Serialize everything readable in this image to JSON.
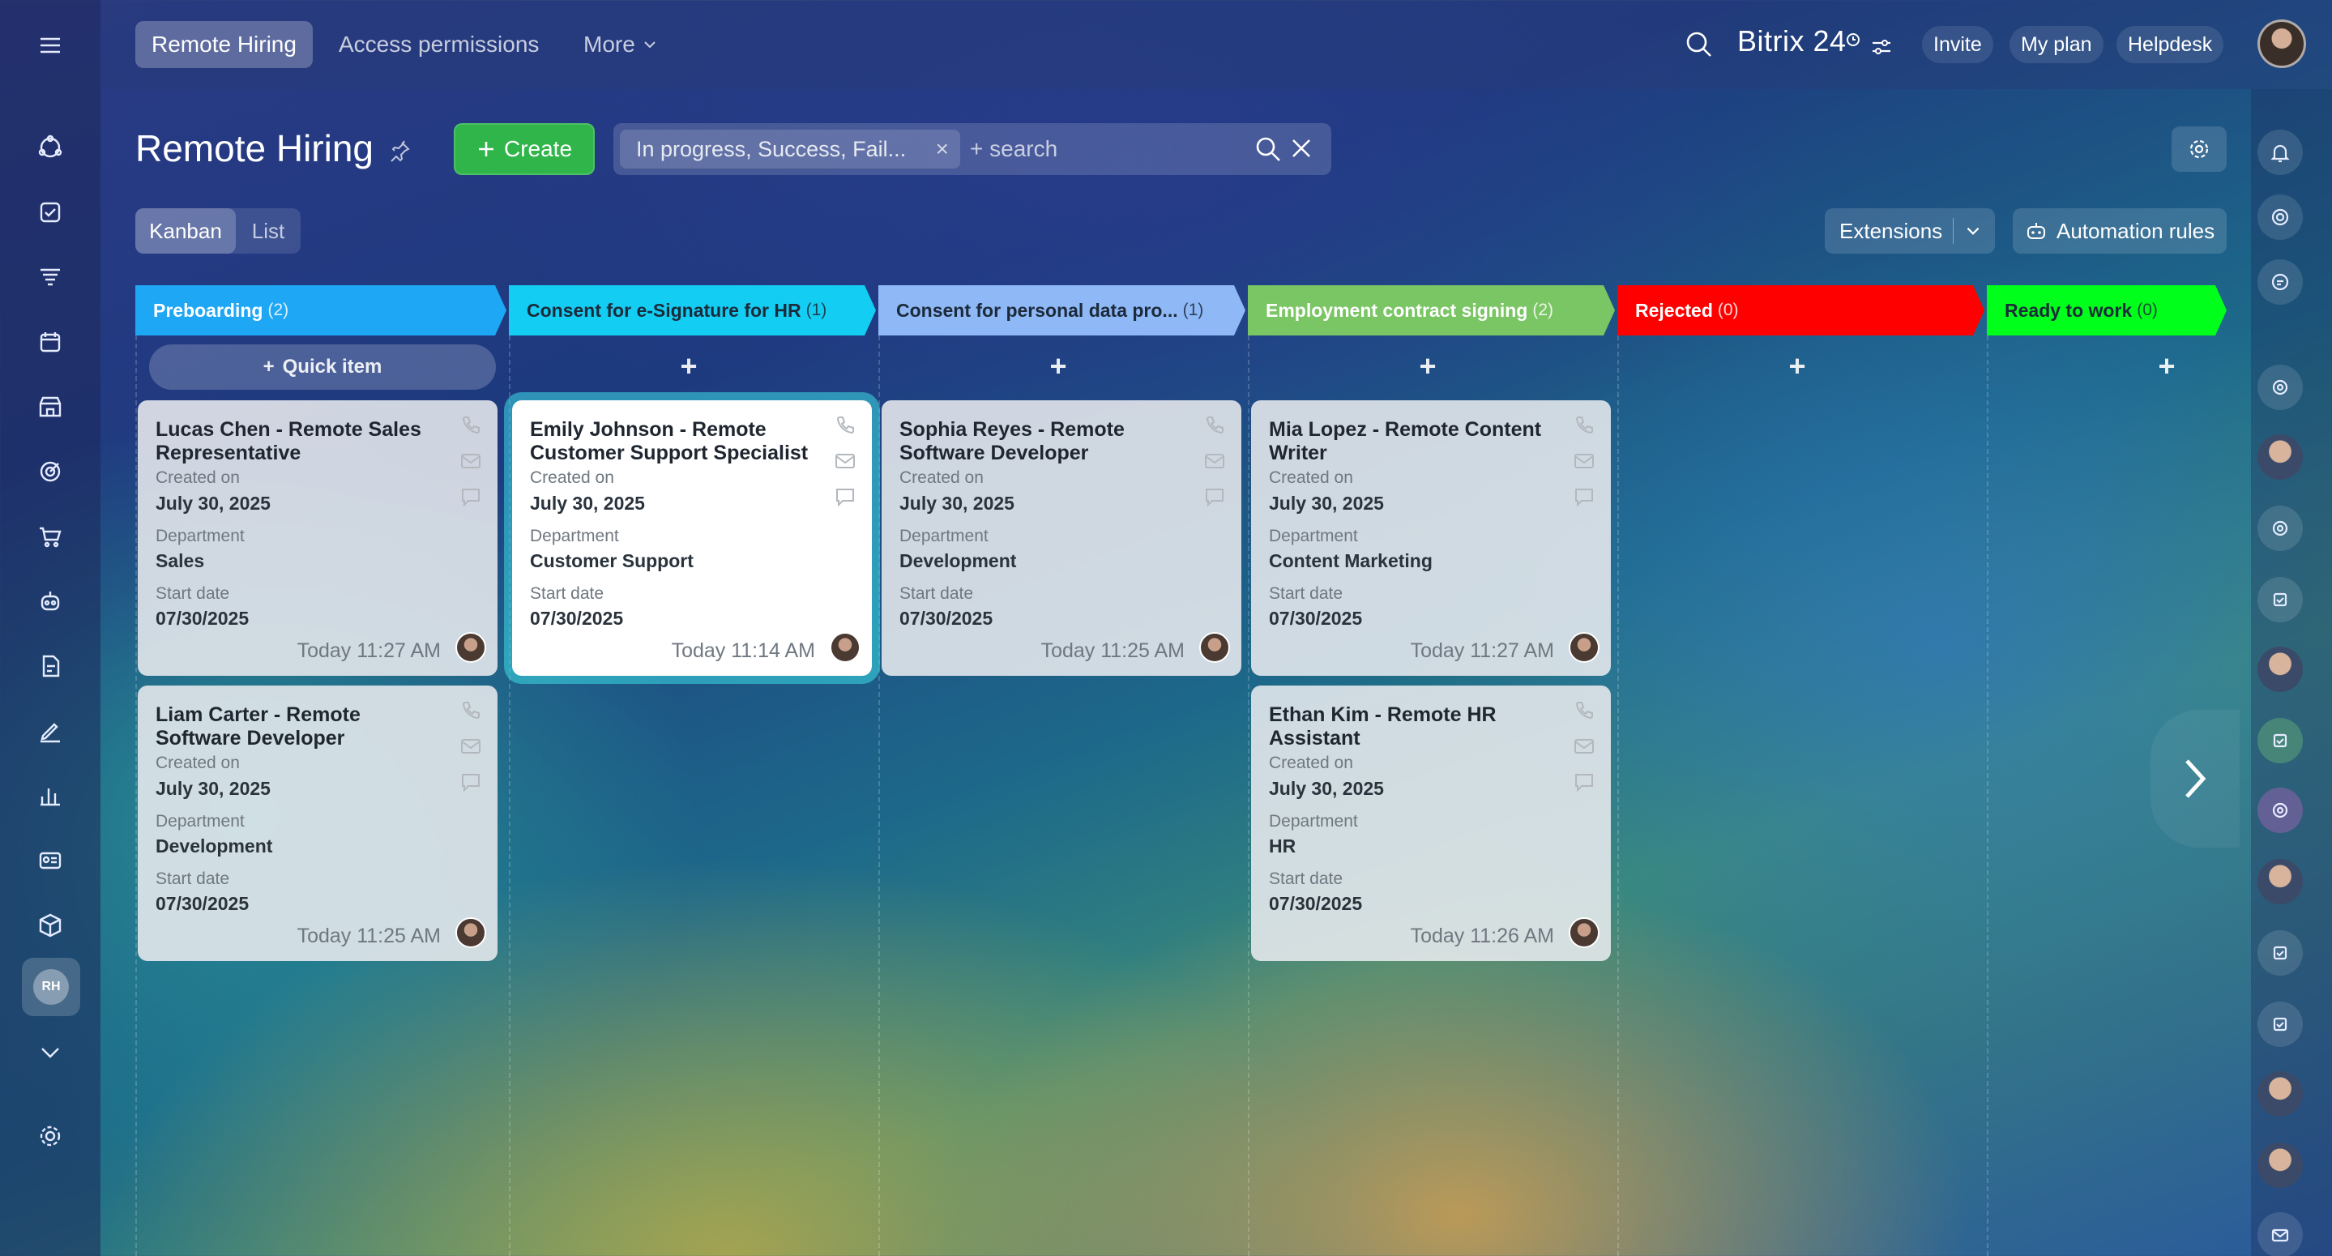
{
  "topbar": {
    "tabs": [
      {
        "label": "Remote Hiring"
      },
      {
        "label": "Access permissions"
      },
      {
        "label": "More"
      }
    ],
    "brand": "Bitrix 24",
    "invite": "Invite",
    "my_plan": "My plan",
    "helpdesk": "Helpdesk"
  },
  "header": {
    "title": "Remote Hiring",
    "create_label": "Create",
    "filter_chip": "In progress, Success, Fail...",
    "search_placeholder": "+ search"
  },
  "view": {
    "kanban": "Kanban",
    "list": "List",
    "extensions": "Extensions",
    "automation": "Automation rules"
  },
  "quick_item_label": "Quick item",
  "stages": [
    {
      "name": "Preboarding",
      "count": "(2)",
      "color": "#1ea7f5"
    },
    {
      "name": "Consent for e-Signature for HR",
      "count": "(1)",
      "color": "#13cdf2"
    },
    {
      "name": "Consent for personal data pro...",
      "count": "(1)",
      "color": "#8fb8f7"
    },
    {
      "name": "Employment contract signing",
      "count": "(2)",
      "color": "#7ac564"
    },
    {
      "name": "Rejected",
      "count": "(0)",
      "color": "#ff0000"
    },
    {
      "name": "Ready to work",
      "count": "(0)",
      "color": "#00ff1a"
    }
  ],
  "card_labels": {
    "created_on": "Created on",
    "department": "Department",
    "start_date": "Start date"
  },
  "cards": [
    {
      "title": "Lucas Chen - Remote Sales Representative",
      "created": "July 30, 2025",
      "department": "Sales",
      "start": "07/30/2025",
      "time": "Today 11:27 AM"
    },
    {
      "title": "Liam Carter - Remote Software Developer",
      "created": "July 30, 2025",
      "department": "Development",
      "start": "07/30/2025",
      "time": "Today 11:25 AM"
    },
    {
      "title": "Emily Johnson - Remote Customer Support Specialist",
      "created": "July 30, 2025",
      "department": "Customer Support",
      "start": "07/30/2025",
      "time": "Today 11:14 AM"
    },
    {
      "title": "Sophia Reyes - Remote Software Developer",
      "created": "July 30, 2025",
      "department": "Development",
      "start": "07/30/2025",
      "time": "Today 11:25 AM"
    },
    {
      "title": "Mia Lopez - Remote Content Writer",
      "created": "July 30, 2025",
      "department": "Content Marketing",
      "start": "07/30/2025",
      "time": "Today 11:27 AM"
    },
    {
      "title": "Ethan Kim - Remote HR Assistant",
      "created": "July 30, 2025",
      "department": "HR",
      "start": "07/30/2025",
      "time": "Today 11:26 AM"
    }
  ],
  "sidebar": {
    "avatar_initials": "RH"
  },
  "icons": {
    "menu": "hamburger-icon",
    "search": "search-icon",
    "settings": "gear-icon",
    "bell": "bell-icon",
    "phone": "phone-icon",
    "mail": "mail-icon",
    "chat": "chat-icon"
  }
}
